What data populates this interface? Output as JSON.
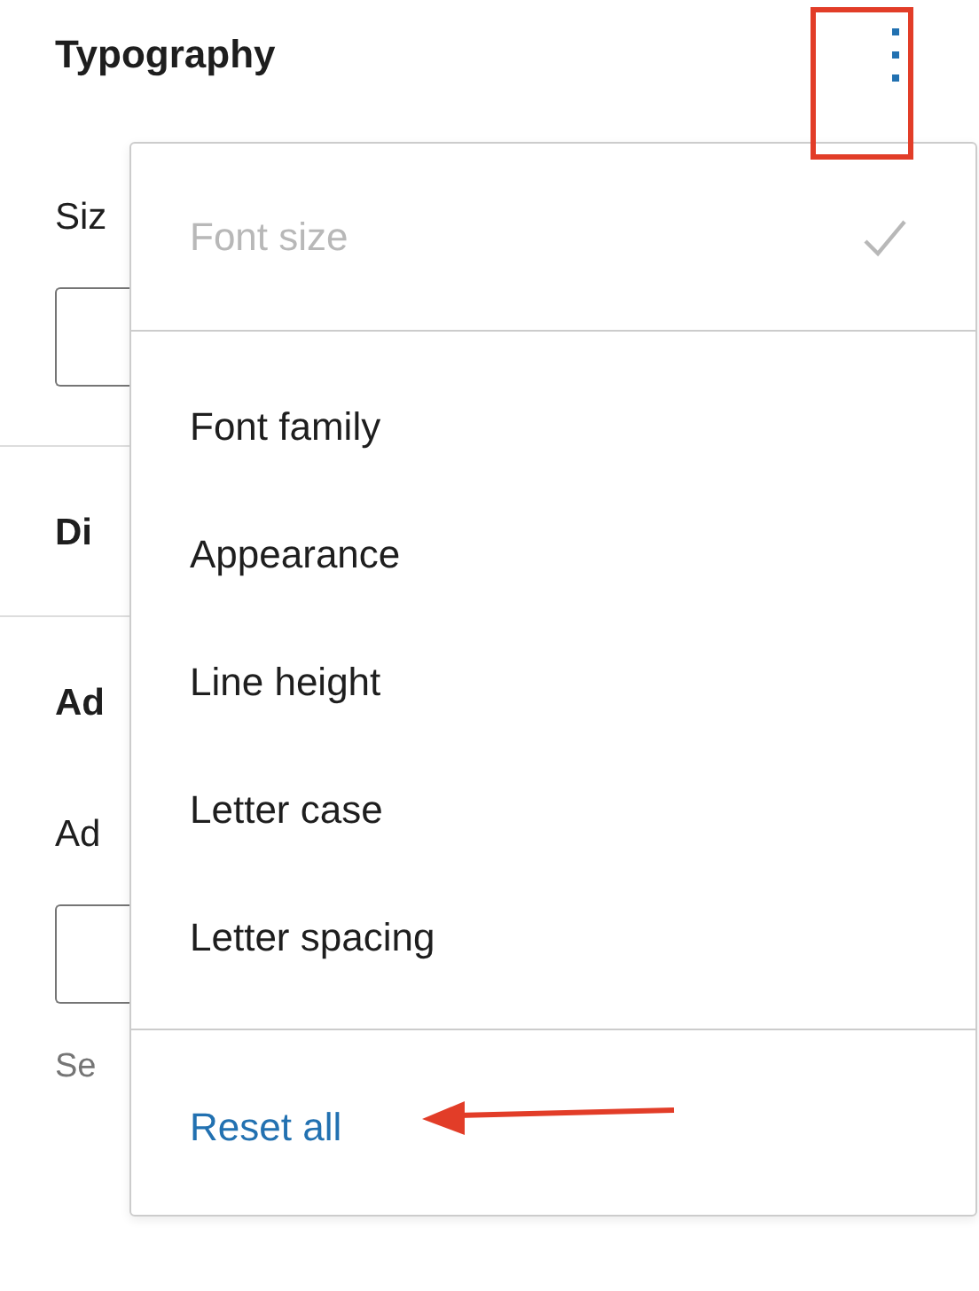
{
  "panel": {
    "title": "Typography",
    "rows": [
      {
        "kind": "label",
        "text": "Siz"
      },
      {
        "kind": "field"
      },
      {
        "kind": "divider"
      },
      {
        "kind": "heading",
        "text": "Di"
      },
      {
        "kind": "divider"
      },
      {
        "kind": "heading",
        "text": "Ad"
      },
      {
        "kind": "label",
        "text": "Ad"
      },
      {
        "kind": "field"
      },
      {
        "kind": "help",
        "text": "Se"
      }
    ]
  },
  "menu": {
    "groups": [
      {
        "items": [
          {
            "kind": "option",
            "label": "Font size",
            "checked": true,
            "disabled": true
          }
        ]
      },
      {
        "items": [
          {
            "kind": "option",
            "label": "Font family",
            "checked": false,
            "disabled": false
          },
          {
            "kind": "option",
            "label": "Appearance",
            "checked": false,
            "disabled": false
          },
          {
            "kind": "option",
            "label": "Line height",
            "checked": false,
            "disabled": false
          },
          {
            "kind": "option",
            "label": "Letter case",
            "checked": false,
            "disabled": false
          },
          {
            "kind": "option",
            "label": "Letter spacing",
            "checked": false,
            "disabled": false
          }
        ]
      },
      {
        "items": [
          {
            "kind": "action",
            "label": "Reset all"
          }
        ]
      }
    ]
  }
}
